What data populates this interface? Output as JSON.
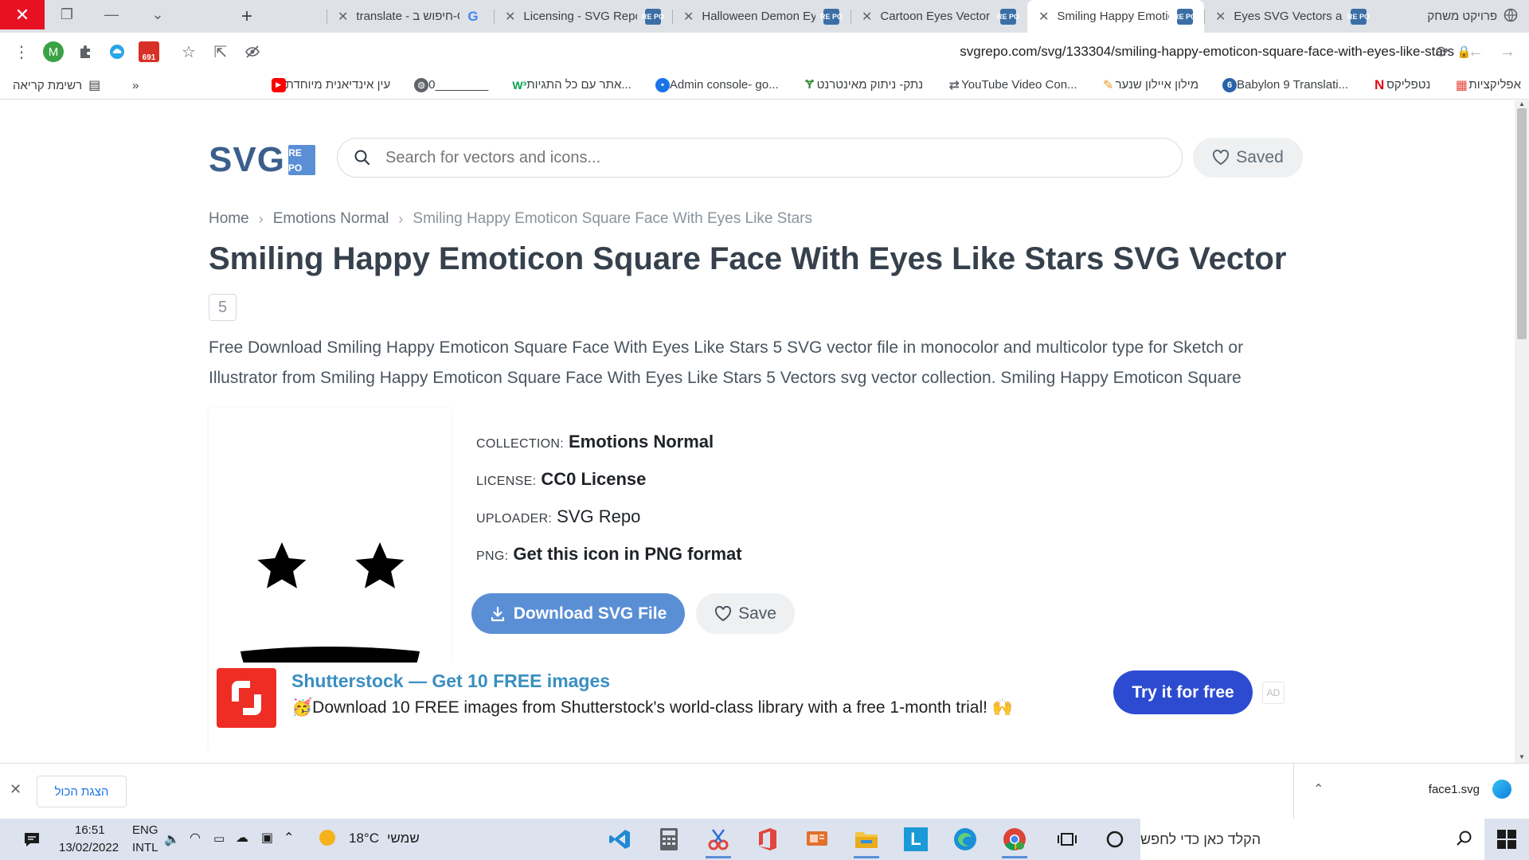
{
  "browser": {
    "tabs": [
      {
        "title": "פרויקט משחק",
        "icon": "globe-icon",
        "active": false
      },
      {
        "title": "Eyes SVG Vectors and",
        "icon": "svgrepo-icon",
        "active": false
      },
      {
        "title": "Smiling Happy Emotic",
        "icon": "svgrepo-icon",
        "active": true
      },
      {
        "title": "Cartoon Eyes Vector S",
        "icon": "svgrepo-icon",
        "active": false
      },
      {
        "title": "Halloween Demon Ey",
        "icon": "svgrepo-icon",
        "active": false
      },
      {
        "title": "Licensing - SVG Repo",
        "icon": "svgrepo-icon",
        "active": false
      },
      {
        "title": "translate - חיפוש ב-G",
        "icon": "google-icon",
        "active": false
      }
    ],
    "favicon_text": "RE PO",
    "url": "svgrepo.com/svg/133304/smiling-happy-emoticon-square-face-with-eyes-like-stars",
    "mail_badge": "691",
    "profile_initial": "M",
    "bookmarks": [
      {
        "label": "אפליקציות",
        "color": "#e8453c"
      },
      {
        "label": "נטפליקס",
        "color": "#e50914"
      },
      {
        "label": "Babylon 9 Translati...",
        "color": "#2a64a8"
      },
      {
        "label": "מילון איילון שנער",
        "color": "#e39b2b"
      },
      {
        "label": "YouTube Video Con...",
        "color": "#5f6368"
      },
      {
        "label": "נתק- ניתוק מאינטרנט",
        "color": "#3b8a3e"
      },
      {
        "label": "Admin console- go...",
        "color": "#1a73e8"
      },
      {
        "label": "אתר עם כל התגיות...",
        "color": "#0aa34f"
      },
      {
        "label": "0________",
        "color": "#5f6368"
      },
      {
        "label": "עין אינדיאנית מיוחדת",
        "color": "#ff0000"
      }
    ],
    "bookmarks_more": "»",
    "reading_list": "רשימת קריאה"
  },
  "site": {
    "logo_text": "SVG",
    "logo_box": [
      "RE",
      "PO"
    ],
    "search_placeholder": "Search for vectors and icons...",
    "saved_label": "Saved",
    "breadcrumb": [
      "Home",
      "Emotions Normal",
      "Smiling Happy Emoticon Square Face With Eyes Like Stars"
    ],
    "title": "Smiling Happy Emoticon Square Face With Eyes Like Stars SVG Vector",
    "count": "5",
    "description": "Free Download Smiling Happy Emoticon Square Face With Eyes Like Stars 5 SVG vector file in monocolor and multicolor type for Sketch or Illustrator from Smiling Happy Emoticon Square Face With Eyes Like Stars 5 Vectors svg vector collection. Smiling Happy Emoticon Square",
    "meta": {
      "collection_key": "COLLECTION:",
      "collection_val": "Emotions Normal",
      "license_key": "LICENSE:",
      "license_val": "CC0 License",
      "uploader_key": "UPLOADER:",
      "uploader_val": "SVG Repo",
      "png_key": "PNG:",
      "png_val": "Get this icon in PNG format"
    },
    "download_label": "Download SVG File",
    "save_label": "Save",
    "ad": {
      "title": "Shutterstock — Get 10 FREE images",
      "text": "🥳Download 10 FREE images from Shutterstock's world-class library with a free 1-month trial! 🙌",
      "cta": "Try it for free",
      "label": "AD"
    }
  },
  "shelf": {
    "show_all": "הצגת הכול",
    "file_name": "face1.svg"
  },
  "taskbar": {
    "search_placeholder": "הקלד כאן כדי לחפש",
    "weather_temp": "18°C",
    "weather_text": "שמשי",
    "lang_1": "ENG",
    "lang_2": "INTL",
    "time": "16:51",
    "date": "13/02/2022"
  }
}
